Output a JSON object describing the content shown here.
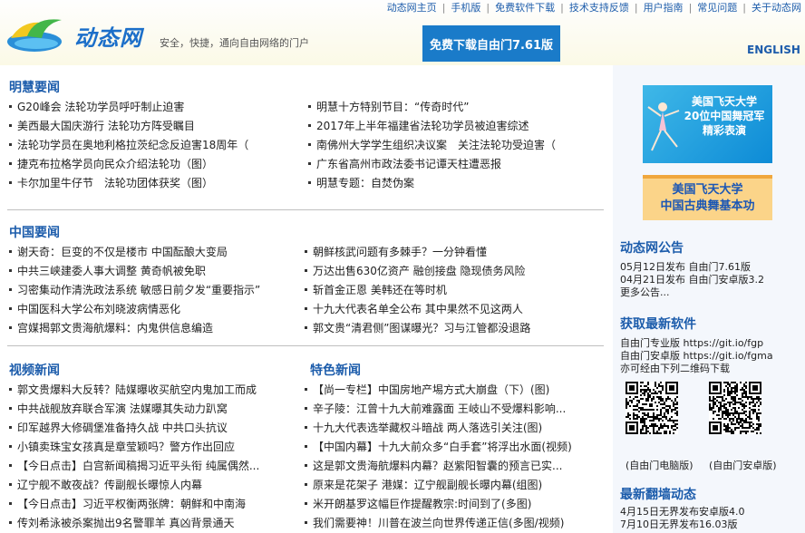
{
  "header": {
    "topnav": [
      "动态网主页",
      "手机版",
      "免费软件下载",
      "技术支持反馈",
      "用户指南",
      "常见问题",
      "关于动态网"
    ],
    "logo_text": "动态网",
    "slogan": "安全，快捷，通向自由网络的门户",
    "download_button": "免费下载自由门7.61版",
    "english": "ENGLISH"
  },
  "minghui": {
    "title": "明慧要闻",
    "left": [
      "G20峰会 法轮功学员呼吁制止迫害",
      "美西最大国庆游行 法轮功方阵受瞩目",
      "法轮功学员在奥地利格拉茨纪念反迫害18周年（",
      "捷克布拉格学员向民众介绍法轮功（图）",
      "卡尔加里牛仔节　法轮功团体获奖（图）"
    ],
    "right": [
      "明慧十方特别节目：“传奇时代”",
      "2017年上半年福建省法轮功学员被迫害综述",
      "南佛州大学学生组织决议案　关注法轮功受迫害（",
      "广东省高州市政法委书记谭天柱遭恶报",
      "明慧专题：自焚伪案"
    ]
  },
  "china": {
    "title": "中国要闻",
    "left": [
      "谢天奇：巨变的不仅是楼市 中国酝酿大变局",
      "中共三峡建委人事大调整 黄奇帆被免职",
      "习密集动作清洗政法系统 敏感日前夕发“重要指示”",
      "中国医科大学公布刘晓波病情恶化",
      "宫媒揭郭文贵海航爆料：内鬼供信息编造"
    ],
    "right": [
      "朝鲜核武问题有多棘手？一分钟看懂",
      "万达出售630亿资产 融创接盘 隐现债务风险",
      "斩首金正恩 美韩还在等时机",
      "十九大代表名单全公布 其中果然不见这两人",
      "郭文贵“清君侧”图谋曝光？习与江管都没退路"
    ]
  },
  "video": {
    "title": "视频新闻",
    "items": [
      "郭文贵爆料大反转？陆媒曝收买航空内鬼加工而成",
      "中共战舰放弃联合军演 法媒曝其失动力趴窝",
      "印军越界大修碉堡准备持久战 中共口头抗议",
      "小镇卖珠宝女孩真是章莹颖吗？警方作出回应",
      "【今日点击】白宫新闻稿揭习近平头衔 纯属偶然...",
      "辽宁舰不敢夜战？传副舰长曝惊人内幕",
      "【今日点击】习近平权衡两张牌：朝鲜和中南海",
      "传刘希泳被杀案抛出9名警罪羊 真凶背景通天"
    ]
  },
  "feature": {
    "title": "特色新闻",
    "items": [
      "【尚一专栏】中国房地产埸方式大崩盘（下）(图)",
      "辛子陵：江曾十九大前难露面 王岐山不受爆料影响...",
      "十九大代表选举藏权斗暗战 两人落选引关注(图)",
      "【中国内幕】十九大前众多“白手套”将浮出水面(视频)",
      "这是郭文贵海航爆料内幕？赵紫阳智囊的预言已实...",
      "原来是花架子 港媒：辽宁舰副舰长曝内幕(组图)",
      "米开朗基罗这幅巨作提醒教宗:时间到了(多图)",
      "我们需要神！川普在波兰向世界传递正信(多图/视频)"
    ]
  },
  "sidebar": {
    "banner1": [
      "美国飞天大学",
      "20位中国舞冠军",
      "精彩表演"
    ],
    "banner2": [
      "美国飞天大学",
      "中国古典舞基本功"
    ],
    "notice_title": "动态网公告",
    "notices": [
      "05月12日发布 自由门7.61版",
      "04月21日发布 自由门安卓版3.2",
      "更多公告..."
    ],
    "software_title": "获取最新软件",
    "software_lines": [
      "自由门专业版 https://git.io/fgp",
      "自由门安卓版 https://git.io/fgma",
      "亦可经由下列二维码下载"
    ],
    "qr_labels": [
      "(自由门电脑版)",
      "(自由门安卓版)"
    ],
    "dynamics_title": "最新翻墙动态",
    "dynamics": [
      "4月15日无界发布安卓版4.0",
      "7月10日无界发布16.03版"
    ]
  },
  "colors": {
    "link_blue": "#1c5cab",
    "button_blue": "#1a7bc9"
  }
}
